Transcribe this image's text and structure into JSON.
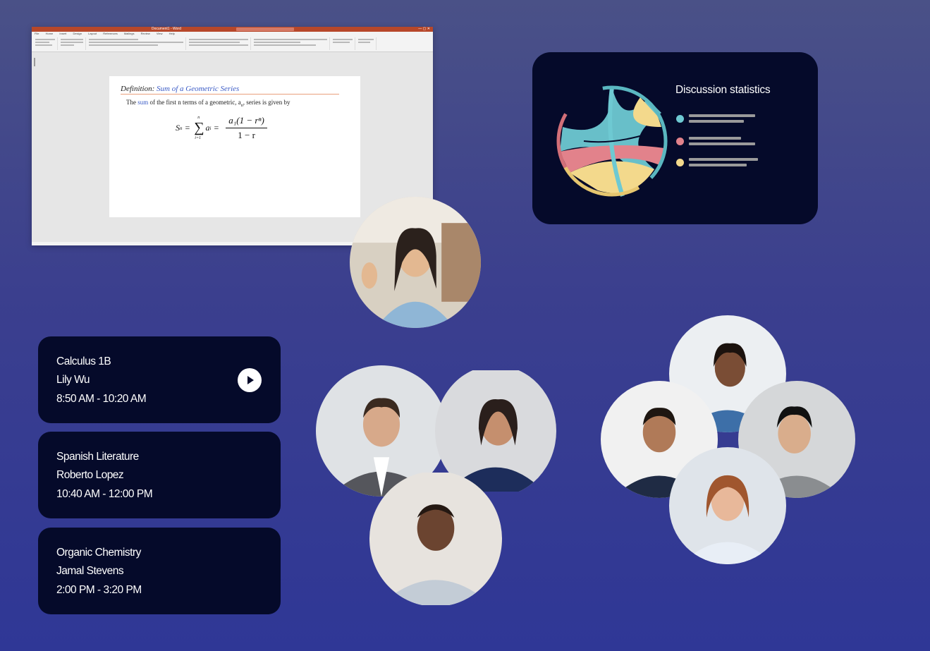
{
  "word_window": {
    "doc_title": "Document1 - Word",
    "menu_tabs": [
      "File",
      "Home",
      "Insert",
      "Design",
      "Layout",
      "References",
      "Mailings",
      "Review",
      "View",
      "Help"
    ],
    "definition_label": "Definition:",
    "definition_name": "Sum of a Geometric Series",
    "definition_text_1": "The",
    "definition_text_sum": "sum",
    "definition_text_2": "of the first n terms of a geometric, a",
    "definition_text_sub": "n",
    "definition_text_3": ", series is given by",
    "formula": {
      "lhs": "S",
      "lhs_sub": "n",
      "sum_top": "n",
      "sum_bottom": "i=1",
      "term": "a",
      "term_sub": "i",
      "numerator": "a₁(1 − rⁿ)",
      "denominator": "1 − r"
    }
  },
  "stats_card": {
    "title": "Discussion statistics",
    "colors": {
      "teal": "#6ec9d2",
      "pink": "#e2828b",
      "yellow": "#f3d98c",
      "card": "#050a2a"
    }
  },
  "classes": [
    {
      "course": "Calculus 1B",
      "teacher": "Lily Wu",
      "time": "8:50 AM - 10:20 AM",
      "has_play": true
    },
    {
      "course": "Spanish Literature",
      "teacher": "Roberto Lopez",
      "time": "10:40 AM - 12:00 PM",
      "has_play": false
    },
    {
      "course": "Organic Chemistry",
      "teacher": "Jamal Stevens",
      "time": "2:00 PM - 3:20 PM",
      "has_play": false
    }
  ],
  "icons": {
    "play": "play-icon",
    "chord": "chord-diagram-icon"
  }
}
